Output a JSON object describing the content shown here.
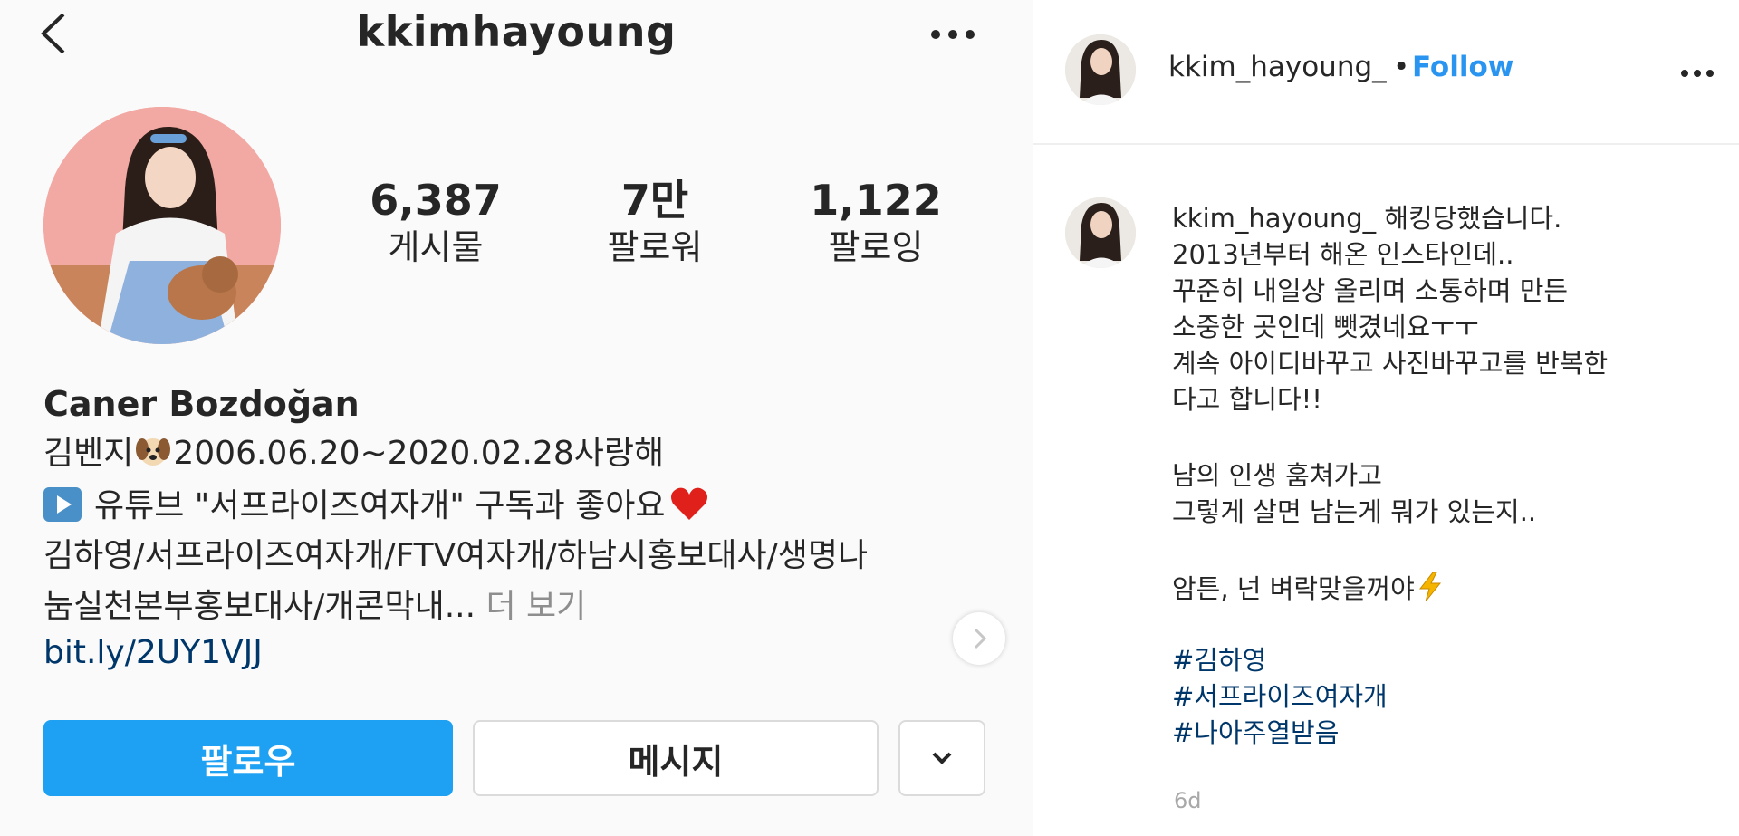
{
  "profile": {
    "title": "kkimhayoung",
    "stats": [
      {
        "value": "6,387",
        "label": "게시물"
      },
      {
        "value": "7만",
        "label": "팔로워"
      },
      {
        "value": "1,122",
        "label": "팔로잉"
      }
    ],
    "display_name": "Caner Bozdoğan",
    "bio_line1_a": "김벤지",
    "bio_line1_b": "2006.06.20~2020.02.28사랑해",
    "bio_line2": "유튜브 \"서프라이즈여자개\" 구독과 좋아요",
    "bio_line3": "김하영/서프라이즈여자개/FTV여자개/하남시홍보대사/생명나",
    "bio_line4": "눔실천본부홍보대사/개콘막내...",
    "bio_more": "더 보기",
    "link": "bit.ly/2UY1VJJ",
    "follow_button": "팔로우",
    "message_button": "메시지",
    "icons": {
      "back": "chevron-left-icon",
      "more": "more-horizontal-icon",
      "dropdown": "chevron-down-icon",
      "next": "chevron-right-icon"
    }
  },
  "post": {
    "username": "kkim_hayoung_",
    "separator": "•",
    "follow_label": "Follow",
    "caption_user": "kkim_hayoung_",
    "caption_lines": [
      "해킹당했습니다.",
      "2013년부터 해온 인스타인데..",
      "꾸준히 내일상 올리며 소통하며 만든",
      "소중한 곳인데 뺏겼네요ㅜㅜ",
      "계속 아이디바꾸고 사진바꾸고를 반복한",
      "다고 합니다!!",
      "남의 인생 훔쳐가고",
      "그렇게 살면 남는게 뭐가 있는지..",
      "암튼, 넌 벼락맞을꺼야"
    ],
    "hashtags": [
      "#김하영",
      "#서프라이즈여자개",
      "#나아주열받음"
    ],
    "time": "6d",
    "colors": {
      "follow_blue": "#2a95f0",
      "hashtag": "#00376b"
    }
  }
}
